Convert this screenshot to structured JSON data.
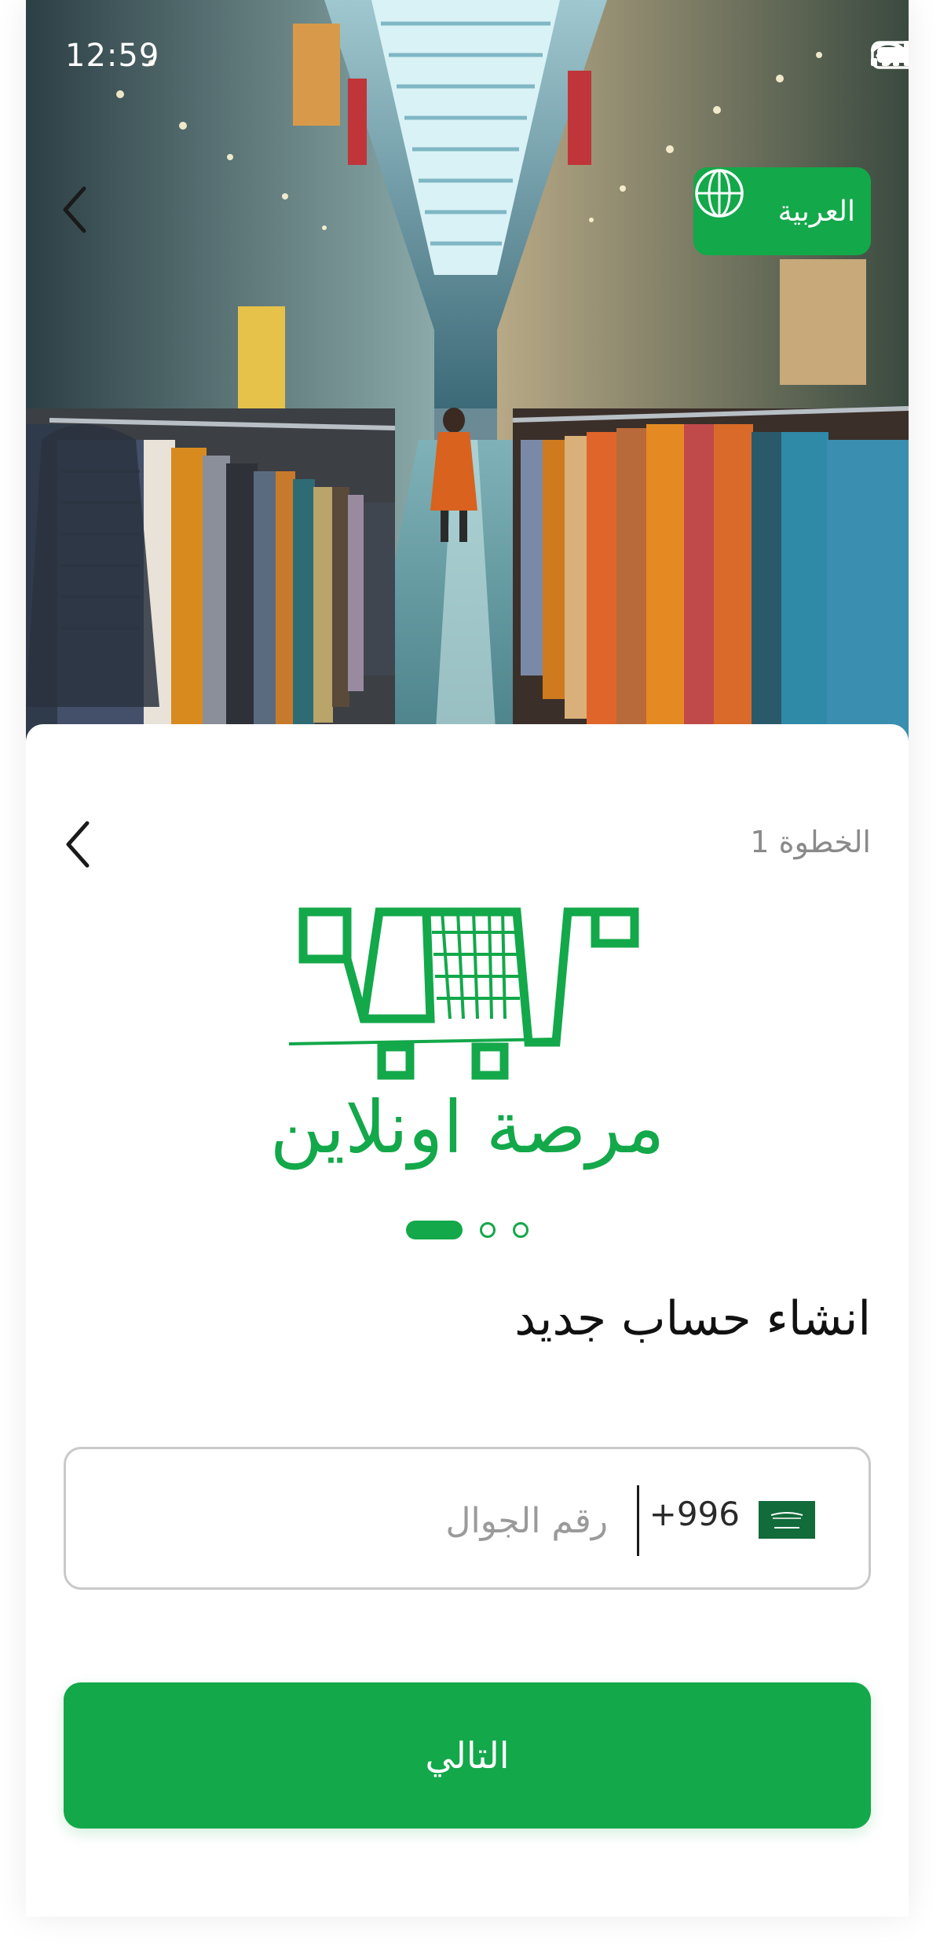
{
  "status_bar": {
    "time": "12:59",
    "icons": [
      "signal-icon",
      "wifi-icon",
      "battery-icon"
    ]
  },
  "hero": {
    "language_button_label": "العربية",
    "language_icon": "globe-icon",
    "back_icon": "chevron-left-icon"
  },
  "card": {
    "step_label": "الخطوة 1",
    "back_icon": "chevron-left-icon",
    "logo": {
      "icon": "shopping-cart-logo-icon",
      "text": "مرصة اونلاين"
    },
    "pager": {
      "count": 3,
      "active_index": 0
    },
    "heading": "انشاء حساب جديد",
    "phone_field": {
      "flag_icon": "saudi-flag-icon",
      "dial_code": "+996",
      "placeholder": "رقم الجوال",
      "value": ""
    },
    "next_button_label": "التالي"
  },
  "colors": {
    "brand_green": "#13a84a",
    "text_dark": "#111111",
    "text_muted": "#8a8a8a",
    "field_border": "#c9c9c9"
  }
}
